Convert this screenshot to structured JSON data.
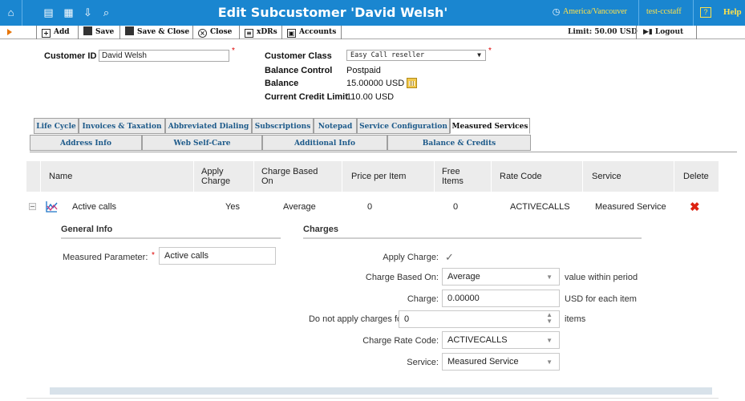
{
  "header": {
    "title": "Edit Subcustomer 'David Welsh'",
    "timezone": "America/Vancouver",
    "user": "test-ccstaff",
    "help": "Help",
    "icons": [
      "home-icon",
      "list-icon",
      "grid-icon",
      "download-icon",
      "search-icon",
      "clock-icon",
      "question-icon"
    ]
  },
  "toolbar": {
    "add": "Add",
    "save": "Save",
    "save_close": "Save & Close",
    "close": "Close",
    "xdrs": "xDRs",
    "accounts": "Accounts",
    "limit": "Limit: 50.00 USD",
    "logout": "Logout"
  },
  "customer": {
    "id_label": "Customer ID",
    "id_value": "David Welsh",
    "class_label": "Customer Class",
    "class_value": "Easy Call reseller",
    "balance_control_label": "Balance Control",
    "balance_control_value": "Postpaid",
    "balance_label": "Balance",
    "balance_value": "15.00000 USD",
    "credit_limit_label": "Current Credit Limit",
    "credit_limit_value": "110.00 USD"
  },
  "tabs_row1": [
    "Life Cycle",
    "Invoices & Taxation",
    "Abbreviated Dialing",
    "Subscriptions",
    "Notepad",
    "Service Configuration",
    "Measured Services"
  ],
  "tabs_row2": [
    "Address Info",
    "Web Self-Care",
    "Additional Info",
    "Balance & Credits"
  ],
  "active_tab": "Measured Services",
  "table": {
    "headers": {
      "name": "Name",
      "apply_charge": "Apply\nCharge",
      "charge_based_on": "Charge Based\nOn",
      "price_per_item": "Price per Item",
      "free_items": "Free\nItems",
      "rate_code": "Rate Code",
      "service": "Service",
      "delete": "Delete"
    },
    "row": {
      "name": "Active calls",
      "apply_charge": "Yes",
      "charge_based_on": "Average",
      "price_per_item": "0",
      "free_items": "0",
      "rate_code": "ACTIVECALLS",
      "service": "Measured Service"
    }
  },
  "detail": {
    "general_info": "General Info",
    "charges": "Charges",
    "measured_param_label": "Measured Parameter:",
    "measured_param_value": "Active calls",
    "apply_charge_label": "Apply Charge:",
    "apply_charge_checked": true,
    "charge_based_on_label": "Charge Based On:",
    "charge_based_on_value": "Average",
    "charge_based_on_suffix": "value within period",
    "charge_label": "Charge:",
    "charge_value": "0.00000",
    "charge_suffix": "USD for each item",
    "free_label": "Do not apply charges for the first:",
    "free_value": "0",
    "free_suffix": "items",
    "rate_code_label": "Charge Rate Code:",
    "rate_code_value": "ACTIVECALLS",
    "service_label": "Service:",
    "service_value": "Measured Service"
  },
  "colors": {
    "topbar": "#1a86d0",
    "accent_yellow": "#ffe24a",
    "tab_text": "#1d5a8a",
    "delete_red": "#d21"
  }
}
